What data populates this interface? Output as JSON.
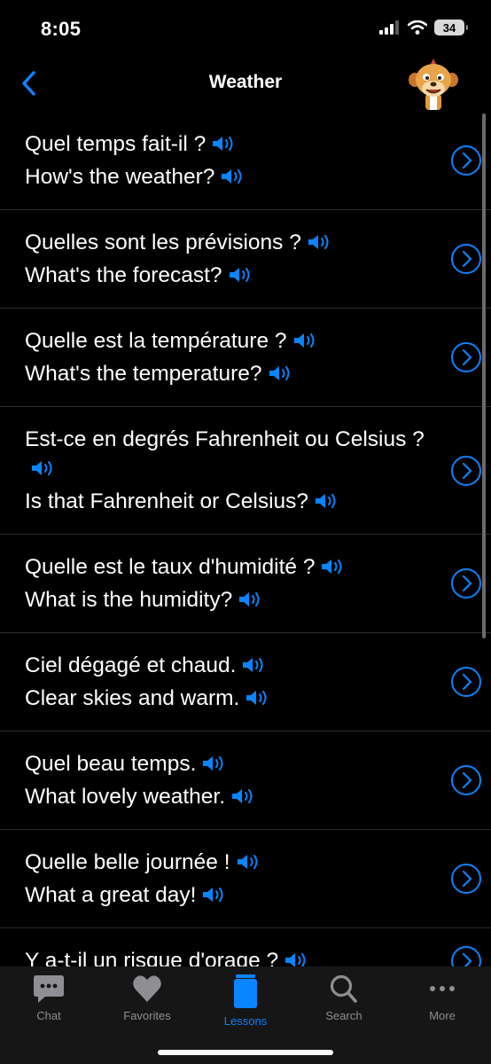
{
  "status_bar": {
    "time": "8:05",
    "battery": "34"
  },
  "nav": {
    "title": "Weather"
  },
  "colors": {
    "accent": "#0a84ff",
    "background": "#000000",
    "tab_bar": "#161616",
    "inactive": "#8e8e93"
  },
  "phrases": [
    {
      "french": "Quel temps fait-il ?",
      "english": "How's the weather?"
    },
    {
      "french": "Quelles sont les prévisions ?",
      "english": "What's the forecast?"
    },
    {
      "french": "Quelle est la température ?",
      "english": "What's the temperature?"
    },
    {
      "french": "Est-ce en degrés Fahrenheit ou Celsius ?",
      "english": "Is that Fahrenheit or Celsius?"
    },
    {
      "french": "Quelle est le taux d'humidité ?",
      "english": "What is the humidity?"
    },
    {
      "french": "Ciel dégagé et chaud.",
      "english": "Clear skies and warm."
    },
    {
      "french": "Quel beau temps.",
      "english": "What lovely weather."
    },
    {
      "french": "Quelle belle journée !",
      "english": "What a great day!"
    },
    {
      "french": "Y a-t-il un risque d'orage ?",
      "english": ""
    }
  ],
  "tabs": [
    {
      "label": "Chat",
      "icon": "chat-bubble-icon",
      "active": false
    },
    {
      "label": "Favorites",
      "icon": "heart-icon",
      "active": false
    },
    {
      "label": "Lessons",
      "icon": "book-stack-icon",
      "active": true
    },
    {
      "label": "Search",
      "icon": "magnifier-icon",
      "active": false
    },
    {
      "label": "More",
      "icon": "ellipsis-icon",
      "active": false
    }
  ]
}
